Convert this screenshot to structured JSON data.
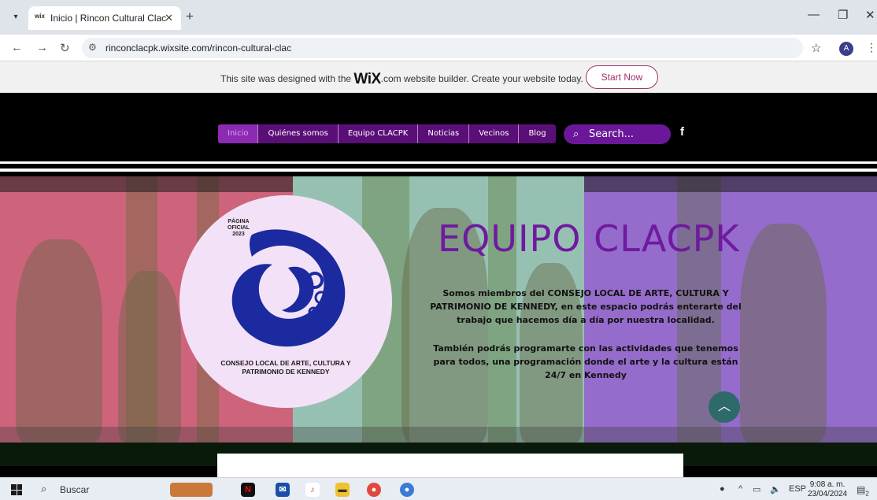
{
  "browser": {
    "tab_title": "Inicio | Rincon Cultural Clac",
    "favicon_text": "wix",
    "url": "rinconclacpk.wixsite.com/rincon-cultural-clac"
  },
  "wix_banner": {
    "text_before": "This site was designed with the ",
    "brand": "WiX",
    "text_after": ".com website builder. Create your website today.",
    "cta": "Start Now"
  },
  "nav": {
    "items": [
      {
        "label": "Inicio",
        "active": true
      },
      {
        "label": "Quiénes somos"
      },
      {
        "label": "Equipo CLACPK"
      },
      {
        "label": "Noticias"
      },
      {
        "label": "Vecinos"
      },
      {
        "label": "Blog"
      }
    ],
    "search_placeholder": "Search...",
    "social": "f"
  },
  "hero": {
    "logo_top": "PÁGINA OFICIAL 2023",
    "logo_caption": "CONSEJO LOCAL DE ARTE, CULTURA Y PATRIMONIO DE KENNEDY",
    "title": "EQUIPO CLACPK",
    "paragraph1": "Somos miembros del CONSEJO LOCAL DE ARTE, CULTURA Y PATRIMONIO DE KENNEDY, en este espacio podrás enterarte del trabajo que hacemos día a día por nuestra localidad.",
    "paragraph2": "También podrás programarte con las actividades que tenemos para todos, una programación donde el arte y la cultura están 24/7 en Kennedy",
    "band_colors": [
      "#e86a88",
      "#a6d9c7",
      "#a575e4"
    ],
    "title_color": "#6f1a9f"
  },
  "taskbar": {
    "search_placeholder": "Buscar",
    "lang": "ESP",
    "time": "9:08 a. m.",
    "date": "23/04/2024",
    "notif_count": "2"
  },
  "colors": {
    "menu_bg": "#5a0f78",
    "accent": "#a0306b"
  }
}
